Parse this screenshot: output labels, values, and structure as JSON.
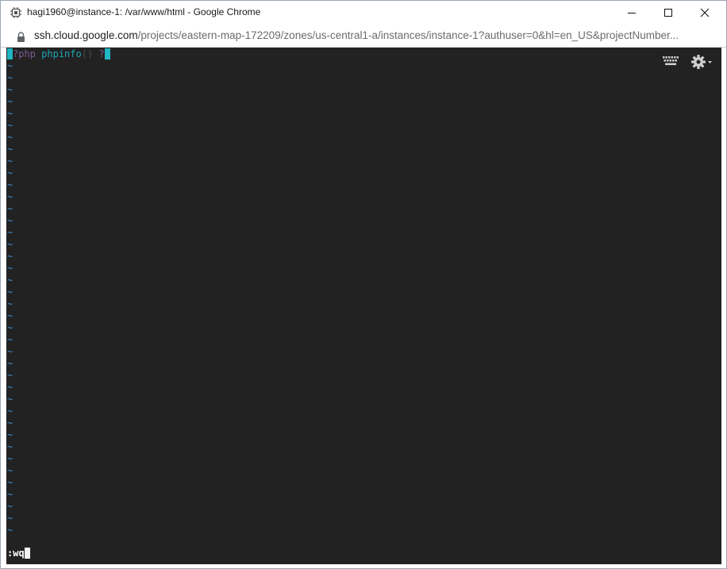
{
  "window": {
    "title": "hagi1960@instance-1: /var/www/html - Google Chrome"
  },
  "address": {
    "host": "ssh.cloud.google.com",
    "path": "/projects/eastern-map-172209/zones/us-central1-a/instances/instance-1?authuser=0&hl=en_US&projectNumber..."
  },
  "editor": {
    "code": {
      "open_rest": "?php",
      "func": "phpinfo",
      "parens": "()",
      "close_q": "?"
    },
    "empty_line_marker": "~",
    "command": ":wq"
  },
  "icons": {
    "app": "chip-icon",
    "lock": "lock-icon",
    "keyboard": "keyboard-icon",
    "settings": "gear-icon"
  },
  "colors": {
    "terminal_bg": "#222222",
    "cursor": "#1fb5c2",
    "tilde": "#3a8fd6"
  }
}
